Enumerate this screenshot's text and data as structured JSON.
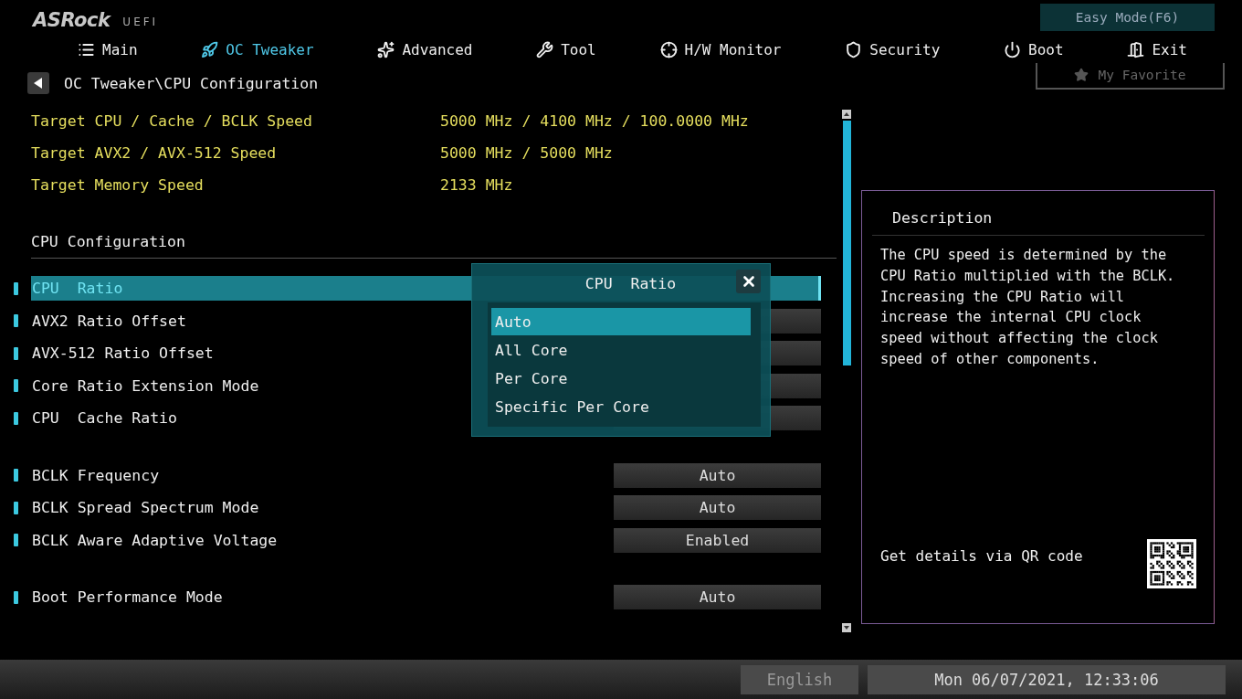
{
  "logo": {
    "brand": "ASRock",
    "sub": "UEFI"
  },
  "easy_mode_button": "Easy Mode(F6)",
  "tabs": [
    {
      "label": "Main",
      "selected": false
    },
    {
      "label": "OC Tweaker",
      "selected": true
    },
    {
      "label": "Advanced",
      "selected": false
    },
    {
      "label": "Tool",
      "selected": false
    },
    {
      "label": "H/W Monitor",
      "selected": false
    },
    {
      "label": "Security",
      "selected": false
    },
    {
      "label": "Boot",
      "selected": false
    },
    {
      "label": "Exit",
      "selected": false
    }
  ],
  "favorite_button": "My Favorite",
  "breadcrumb": "OC Tweaker\\CPU Configuration",
  "targets": [
    {
      "label": "Target CPU / Cache / BCLK Speed",
      "value": "5000 MHz / 4100 MHz / 100.0000 MHz"
    },
    {
      "label": "Target AVX2 / AVX-512 Speed",
      "value": "5000 MHz / 5000 MHz"
    },
    {
      "label": "Target Memory Speed",
      "value": "2133 MHz"
    }
  ],
  "section_title": "CPU Configuration",
  "setting_groups": [
    [
      {
        "label": "CPU  Ratio",
        "selected": true
      },
      {
        "label": "AVX2 Ratio Offset",
        "selected": false
      },
      {
        "label": "AVX-512 Ratio Offset",
        "selected": false
      },
      {
        "label": "Core Ratio Extension Mode",
        "selected": false
      },
      {
        "label": "CPU  Cache Ratio",
        "selected": false
      }
    ],
    [
      {
        "label": "BCLK Frequency",
        "selected": false,
        "value": "Auto"
      },
      {
        "label": "BCLK Spread Spectrum Mode",
        "selected": false,
        "value": "Auto"
      },
      {
        "label": "BCLK Aware Adaptive Voltage",
        "selected": false,
        "value": "Enabled"
      }
    ],
    [
      {
        "label": "Boot Performance Mode",
        "selected": false,
        "value": "Auto"
      }
    ]
  ],
  "popup": {
    "title": "CPU  Ratio",
    "options": [
      {
        "label": "Auto",
        "selected": true
      },
      {
        "label": "All Core",
        "selected": false
      },
      {
        "label": "Per Core",
        "selected": false
      },
      {
        "label": "Specific Per Core",
        "selected": false
      }
    ]
  },
  "description": {
    "title": "Description",
    "text": "The CPU speed is determined by the CPU Ratio multiplied with the BCLK. Increasing the CPU Ratio will increase the internal CPU clock speed without affecting the clock speed of other components.",
    "qr_label": "Get details via QR code"
  },
  "status_bar": {
    "language": "English",
    "datetime": "Mon 06/07/2021, 12:33:06"
  }
}
